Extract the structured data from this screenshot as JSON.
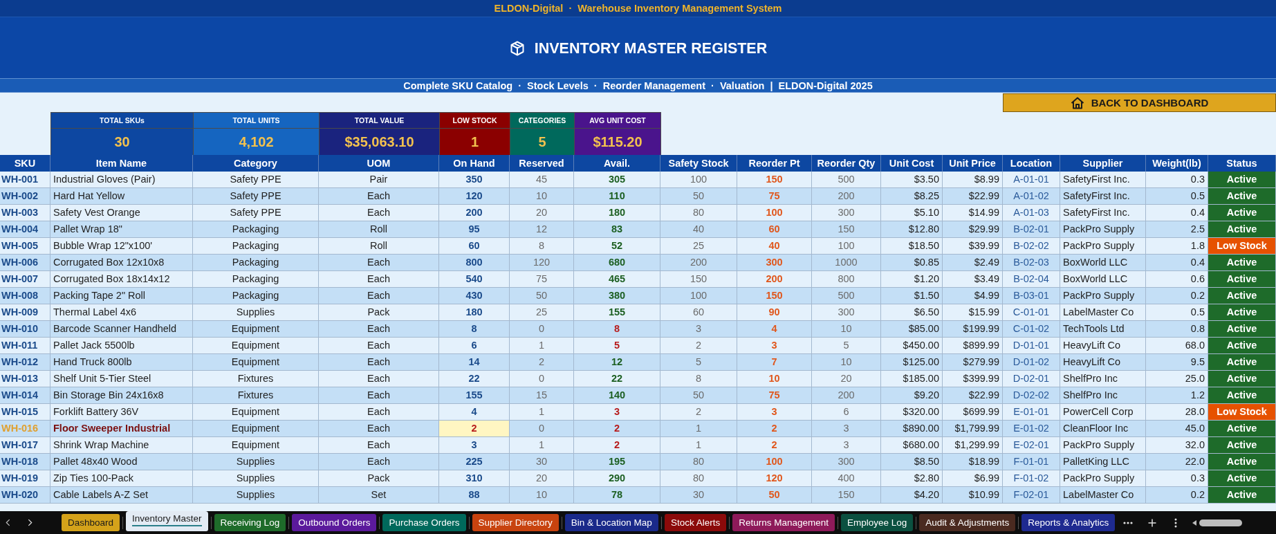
{
  "header": {
    "app_title": "ELDON-Digital  ·  Warehouse Inventory Management System",
    "title": "INVENTORY MASTER REGISTER",
    "subtitle": "Complete SKU Catalog  ·  Stock Levels  ·  Reorder Management  ·  Valuation  |  ELDON-Digital 2025"
  },
  "back_button": {
    "label": "BACK TO DASHBOARD"
  },
  "kpis": [
    {
      "label": "TOTAL SKUs",
      "value": "30",
      "color": "#0d47a1"
    },
    {
      "label": "TOTAL UNITS",
      "value": "4,102",
      "color": "#1565c0"
    },
    {
      "label": "TOTAL VALUE",
      "value": "$35,063.10",
      "color": "#1a237e"
    },
    {
      "label": "LOW STOCK",
      "value": "1",
      "color": "#8b0000"
    },
    {
      "label": "CATEGORIES",
      "value": "5",
      "color": "#00695c"
    },
    {
      "label": "AVG UNIT COST",
      "value": "$115.20",
      "color": "#4a148c"
    }
  ],
  "table": {
    "columns": [
      "SKU",
      "Item Name",
      "Category",
      "UOM",
      "On Hand",
      "Reserved",
      "Avail.",
      "Safety Stock",
      "Reorder Pt",
      "Reorder Qty",
      "Unit Cost",
      "Unit Price",
      "Location",
      "Supplier",
      "Weight(lb)",
      "Status"
    ],
    "rows": [
      {
        "sku": "WH-001",
        "item": "Industrial Gloves (Pair)",
        "category": "Safety PPE",
        "uom": "Pair",
        "on_hand": "350",
        "reserved": "45",
        "avail": "305",
        "safety_stock": "100",
        "reorder_pt": "150",
        "reorder_qty": "500",
        "unit_cost": "$3.50",
        "unit_price": "$8.99",
        "location": "A-01-01",
        "supplier": "SafetyFirst Inc.",
        "weight": "0.3",
        "status": "Active",
        "low_stock": false,
        "avail_low": false,
        "critical": false
      },
      {
        "sku": "WH-002",
        "item": "Hard Hat Yellow",
        "category": "Safety PPE",
        "uom": "Each",
        "on_hand": "120",
        "reserved": "10",
        "avail": "110",
        "safety_stock": "50",
        "reorder_pt": "75",
        "reorder_qty": "200",
        "unit_cost": "$8.25",
        "unit_price": "$22.99",
        "location": "A-01-02",
        "supplier": "SafetyFirst Inc.",
        "weight": "0.5",
        "status": "Active",
        "low_stock": false,
        "avail_low": false,
        "critical": false
      },
      {
        "sku": "WH-003",
        "item": "Safety Vest Orange",
        "category": "Safety PPE",
        "uom": "Each",
        "on_hand": "200",
        "reserved": "20",
        "avail": "180",
        "safety_stock": "80",
        "reorder_pt": "100",
        "reorder_qty": "300",
        "unit_cost": "$5.10",
        "unit_price": "$14.99",
        "location": "A-01-03",
        "supplier": "SafetyFirst Inc.",
        "weight": "0.4",
        "status": "Active",
        "low_stock": false,
        "avail_low": false,
        "critical": false
      },
      {
        "sku": "WH-004",
        "item": "Pallet Wrap 18\"",
        "category": "Packaging",
        "uom": "Roll",
        "on_hand": "95",
        "reserved": "12",
        "avail": "83",
        "safety_stock": "40",
        "reorder_pt": "60",
        "reorder_qty": "150",
        "unit_cost": "$12.80",
        "unit_price": "$29.99",
        "location": "B-02-01",
        "supplier": "PackPro Supply",
        "weight": "2.5",
        "status": "Active",
        "low_stock": false,
        "avail_low": false,
        "critical": false
      },
      {
        "sku": "WH-005",
        "item": "Bubble Wrap 12\"x100'",
        "category": "Packaging",
        "uom": "Roll",
        "on_hand": "60",
        "reserved": "8",
        "avail": "52",
        "safety_stock": "25",
        "reorder_pt": "40",
        "reorder_qty": "100",
        "unit_cost": "$18.50",
        "unit_price": "$39.99",
        "location": "B-02-02",
        "supplier": "PackPro Supply",
        "weight": "1.8",
        "status": "Low Stock",
        "low_stock": true,
        "avail_low": false,
        "critical": false
      },
      {
        "sku": "WH-006",
        "item": "Corrugated Box 12x10x8",
        "category": "Packaging",
        "uom": "Each",
        "on_hand": "800",
        "reserved": "120",
        "avail": "680",
        "safety_stock": "200",
        "reorder_pt": "300",
        "reorder_qty": "1000",
        "unit_cost": "$0.85",
        "unit_price": "$2.49",
        "location": "B-02-03",
        "supplier": "BoxWorld LLC",
        "weight": "0.4",
        "status": "Active",
        "low_stock": false,
        "avail_low": false,
        "critical": false
      },
      {
        "sku": "WH-007",
        "item": "Corrugated Box 18x14x12",
        "category": "Packaging",
        "uom": "Each",
        "on_hand": "540",
        "reserved": "75",
        "avail": "465",
        "safety_stock": "150",
        "reorder_pt": "200",
        "reorder_qty": "800",
        "unit_cost": "$1.20",
        "unit_price": "$3.49",
        "location": "B-02-04",
        "supplier": "BoxWorld LLC",
        "weight": "0.6",
        "status": "Active",
        "low_stock": false,
        "avail_low": false,
        "critical": false
      },
      {
        "sku": "WH-008",
        "item": "Packing Tape 2\" Roll",
        "category": "Packaging",
        "uom": "Each",
        "on_hand": "430",
        "reserved": "50",
        "avail": "380",
        "safety_stock": "100",
        "reorder_pt": "150",
        "reorder_qty": "500",
        "unit_cost": "$1.50",
        "unit_price": "$4.99",
        "location": "B-03-01",
        "supplier": "PackPro Supply",
        "weight": "0.2",
        "status": "Active",
        "low_stock": false,
        "avail_low": false,
        "critical": false
      },
      {
        "sku": "WH-009",
        "item": "Thermal Label 4x6",
        "category": "Supplies",
        "uom": "Pack",
        "on_hand": "180",
        "reserved": "25",
        "avail": "155",
        "safety_stock": "60",
        "reorder_pt": "90",
        "reorder_qty": "300",
        "unit_cost": "$6.50",
        "unit_price": "$15.99",
        "location": "C-01-01",
        "supplier": "LabelMaster Co",
        "weight": "0.5",
        "status": "Active",
        "low_stock": false,
        "avail_low": false,
        "critical": false
      },
      {
        "sku": "WH-010",
        "item": "Barcode Scanner Handheld",
        "category": "Equipment",
        "uom": "Each",
        "on_hand": "8",
        "reserved": "0",
        "avail": "8",
        "safety_stock": "3",
        "reorder_pt": "4",
        "reorder_qty": "10",
        "unit_cost": "$85.00",
        "unit_price": "$199.99",
        "location": "C-01-02",
        "supplier": "TechTools Ltd",
        "weight": "0.8",
        "status": "Active",
        "low_stock": false,
        "avail_low": true,
        "critical": false
      },
      {
        "sku": "WH-011",
        "item": "Pallet Jack 5500lb",
        "category": "Equipment",
        "uom": "Each",
        "on_hand": "6",
        "reserved": "1",
        "avail": "5",
        "safety_stock": "2",
        "reorder_pt": "3",
        "reorder_qty": "5",
        "unit_cost": "$450.00",
        "unit_price": "$899.99",
        "location": "D-01-01",
        "supplier": "HeavyLift Co",
        "weight": "68.0",
        "status": "Active",
        "low_stock": false,
        "avail_low": true,
        "critical": false
      },
      {
        "sku": "WH-012",
        "item": "Hand Truck 800lb",
        "category": "Equipment",
        "uom": "Each",
        "on_hand": "14",
        "reserved": "2",
        "avail": "12",
        "safety_stock": "5",
        "reorder_pt": "7",
        "reorder_qty": "10",
        "unit_cost": "$125.00",
        "unit_price": "$279.99",
        "location": "D-01-02",
        "supplier": "HeavyLift Co",
        "weight": "9.5",
        "status": "Active",
        "low_stock": false,
        "avail_low": false,
        "critical": false
      },
      {
        "sku": "WH-013",
        "item": "Shelf Unit 5-Tier Steel",
        "category": "Fixtures",
        "uom": "Each",
        "on_hand": "22",
        "reserved": "0",
        "avail": "22",
        "safety_stock": "8",
        "reorder_pt": "10",
        "reorder_qty": "20",
        "unit_cost": "$185.00",
        "unit_price": "$399.99",
        "location": "D-02-01",
        "supplier": "ShelfPro Inc",
        "weight": "25.0",
        "status": "Active",
        "low_stock": false,
        "avail_low": false,
        "critical": false
      },
      {
        "sku": "WH-014",
        "item": "Bin Storage Bin 24x16x8",
        "category": "Fixtures",
        "uom": "Each",
        "on_hand": "155",
        "reserved": "15",
        "avail": "140",
        "safety_stock": "50",
        "reorder_pt": "75",
        "reorder_qty": "200",
        "unit_cost": "$9.20",
        "unit_price": "$22.99",
        "location": "D-02-02",
        "supplier": "ShelfPro Inc",
        "weight": "1.2",
        "status": "Active",
        "low_stock": false,
        "avail_low": false,
        "critical": false
      },
      {
        "sku": "WH-015",
        "item": "Forklift Battery 36V",
        "category": "Equipment",
        "uom": "Each",
        "on_hand": "4",
        "reserved": "1",
        "avail": "3",
        "safety_stock": "2",
        "reorder_pt": "3",
        "reorder_qty": "6",
        "unit_cost": "$320.00",
        "unit_price": "$699.99",
        "location": "E-01-01",
        "supplier": "PowerCell Corp",
        "weight": "28.0",
        "status": "Low Stock",
        "low_stock": true,
        "avail_low": true,
        "critical": false
      },
      {
        "sku": "WH-016",
        "item": "Floor Sweeper Industrial",
        "category": "Equipment",
        "uom": "Each",
        "on_hand": "2",
        "reserved": "0",
        "avail": "2",
        "safety_stock": "1",
        "reorder_pt": "2",
        "reorder_qty": "3",
        "unit_cost": "$890.00",
        "unit_price": "$1,799.99",
        "location": "E-01-02",
        "supplier": "CleanFloor Inc",
        "weight": "45.0",
        "status": "Active",
        "low_stock": false,
        "avail_low": true,
        "critical": true
      },
      {
        "sku": "WH-017",
        "item": "Shrink Wrap Machine",
        "category": "Equipment",
        "uom": "Each",
        "on_hand": "3",
        "reserved": "1",
        "avail": "2",
        "safety_stock": "1",
        "reorder_pt": "2",
        "reorder_qty": "3",
        "unit_cost": "$680.00",
        "unit_price": "$1,299.99",
        "location": "E-02-01",
        "supplier": "PackPro Supply",
        "weight": "32.0",
        "status": "Active",
        "low_stock": false,
        "avail_low": true,
        "critical": false
      },
      {
        "sku": "WH-018",
        "item": "Pallet 48x40 Wood",
        "category": "Supplies",
        "uom": "Each",
        "on_hand": "225",
        "reserved": "30",
        "avail": "195",
        "safety_stock": "80",
        "reorder_pt": "100",
        "reorder_qty": "300",
        "unit_cost": "$8.50",
        "unit_price": "$18.99",
        "location": "F-01-01",
        "supplier": "PalletKing LLC",
        "weight": "22.0",
        "status": "Active",
        "low_stock": false,
        "avail_low": false,
        "critical": false
      },
      {
        "sku": "WH-019",
        "item": "Zip Ties 100-Pack",
        "category": "Supplies",
        "uom": "Pack",
        "on_hand": "310",
        "reserved": "20",
        "avail": "290",
        "safety_stock": "80",
        "reorder_pt": "120",
        "reorder_qty": "400",
        "unit_cost": "$2.80",
        "unit_price": "$6.99",
        "location": "F-01-02",
        "supplier": "PackPro Supply",
        "weight": "0.3",
        "status": "Active",
        "low_stock": false,
        "avail_low": false,
        "critical": false
      },
      {
        "sku": "WH-020",
        "item": "Cable Labels A-Z Set",
        "category": "Supplies",
        "uom": "Set",
        "on_hand": "88",
        "reserved": "10",
        "avail": "78",
        "safety_stock": "30",
        "reorder_pt": "50",
        "reorder_qty": "150",
        "unit_cost": "$4.20",
        "unit_price": "$10.99",
        "location": "F-02-01",
        "supplier": "LabelMaster Co",
        "weight": "0.2",
        "status": "Active",
        "low_stock": false,
        "avail_low": false,
        "critical": false
      }
    ]
  },
  "sheet_tabs": [
    {
      "label": "Dashboard",
      "color": "#d4a21a",
      "selected": false
    },
    {
      "label": "Inventory Master",
      "color": "#2a7f8a",
      "selected": true
    },
    {
      "label": "Receiving Log",
      "color": "#1e6b2a",
      "selected": false
    },
    {
      "label": "Outbound Orders",
      "color": "#5b1a9c",
      "selected": false
    },
    {
      "label": "Purchase Orders",
      "color": "#00695c",
      "selected": false
    },
    {
      "label": "Supplier Directory",
      "color": "#c8430f",
      "selected": false
    },
    {
      "label": "Bin & Location Map",
      "color": "#1a2a8a",
      "selected": false
    },
    {
      "label": "Stock Alerts",
      "color": "#8b0a0a",
      "selected": false
    },
    {
      "label": "Returns Management",
      "color": "#8e1a5a",
      "selected": false
    },
    {
      "label": "Employee Log",
      "color": "#0b5040",
      "selected": false
    },
    {
      "label": "Audit & Adjustments",
      "color": "#4a2a20",
      "selected": false
    },
    {
      "label": "Reports & Analytics",
      "color": "#1e2a90",
      "selected": false
    }
  ]
}
